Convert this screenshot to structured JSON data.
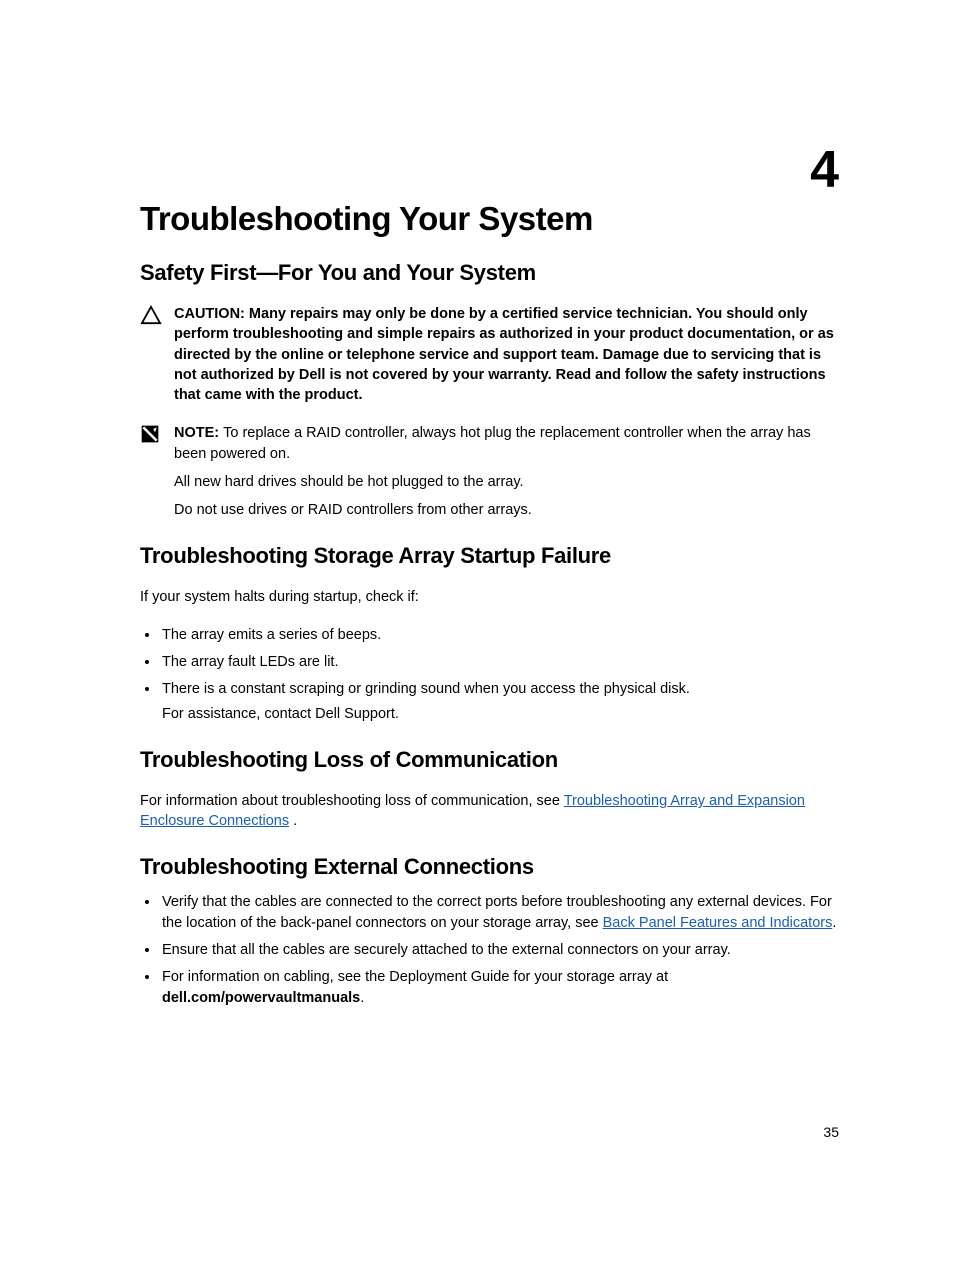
{
  "chapter_number": "4",
  "page_number": "35",
  "title": "Troubleshooting Your System",
  "sections": {
    "safety": {
      "heading": "Safety First—For You and Your System",
      "caution_label": "CAUTION: ",
      "caution_text": "Many repairs may only be done by a certified service technician. You should only perform troubleshooting and simple repairs as authorized in your product documentation, or as directed by the online or telephone service and support team. Damage due to servicing that is not authorized by Dell is not covered by your warranty. Read and follow the safety instructions that came with the product.",
      "note_label": "NOTE: ",
      "note_text": "To replace a RAID controller, always hot plug the replacement controller when the array has been powered on.",
      "note_extra1": "All new hard drives should be hot plugged to the array.",
      "note_extra2": "Do not use drives or RAID controllers from other arrays."
    },
    "startup": {
      "heading": "Troubleshooting Storage Array Startup Failure",
      "intro": "If your system halts during startup, check if:",
      "items": [
        "The array emits a series of beeps.",
        "The array fault LEDs are lit.",
        "There is a constant scraping or grinding sound when you access the physical disk."
      ],
      "last_sub": "For assistance, contact Dell Support."
    },
    "loss": {
      "heading": "Troubleshooting Loss of Communication",
      "pre": "For information about troubleshooting loss of communication, see ",
      "link": "Troubleshooting Array and Expansion Enclosure Connections",
      "post": " ."
    },
    "external": {
      "heading": "Troubleshooting External Connections",
      "item1_pre": "Verify that the cables are connected to the correct ports before troubleshooting any external devices. For the location of the back-panel connectors on your storage array, see ",
      "item1_link": "Back Panel Features and Indicators",
      "item1_post": ".",
      "item2": "Ensure that all the cables are securely attached to the external connectors on your array.",
      "item3_pre": "For information on cabling, see the Deployment Guide for your storage array at ",
      "item3_bold": "dell.com/powervaultmanuals",
      "item3_post": "."
    }
  }
}
